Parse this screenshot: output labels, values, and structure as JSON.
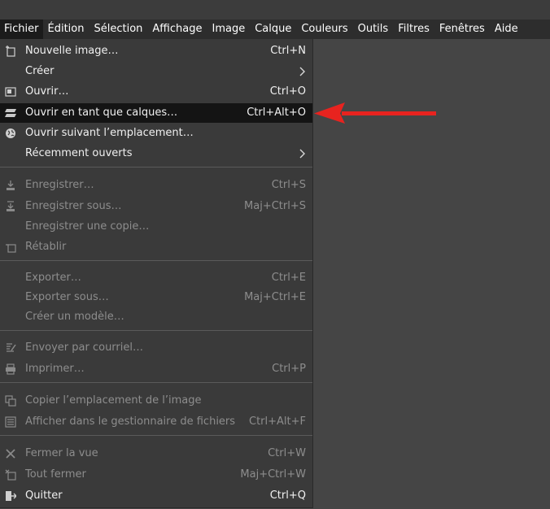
{
  "menubar": {
    "items": [
      "Fichier",
      "Édition",
      "Sélection",
      "Affichage",
      "Image",
      "Calque",
      "Couleurs",
      "Outils",
      "Filtres",
      "Fenêtres",
      "Aide"
    ]
  },
  "file_menu": {
    "items": [
      {
        "label": "Nouvelle image…",
        "shortcut": "Ctrl+N",
        "icon": "new-image-icon",
        "enabled": true
      },
      {
        "label": "Créer",
        "shortcut": "",
        "icon": "",
        "enabled": true,
        "submenu": true
      },
      {
        "label": "Ouvrir…",
        "shortcut": "Ctrl+O",
        "icon": "open-icon",
        "enabled": true
      },
      {
        "label": "Ouvrir en tant que calques…",
        "shortcut": "Ctrl+Alt+O",
        "icon": "layers-icon",
        "enabled": true,
        "selected": true
      },
      {
        "label": "Ouvrir suivant l’emplacement…",
        "shortcut": "",
        "icon": "globe-icon",
        "enabled": true
      },
      {
        "label": "Récemment ouverts",
        "shortcut": "",
        "icon": "",
        "enabled": true,
        "submenu": true
      },
      {
        "label": "Enregistrer…",
        "shortcut": "Ctrl+S",
        "icon": "save-icon",
        "enabled": false
      },
      {
        "label": "Enregistrer sous…",
        "shortcut": "Maj+Ctrl+S",
        "icon": "save-as-icon",
        "enabled": false
      },
      {
        "label": "Enregistrer une copie…",
        "shortcut": "",
        "icon": "",
        "enabled": false
      },
      {
        "label": "Rétablir",
        "shortcut": "",
        "icon": "revert-icon",
        "enabled": false
      },
      {
        "label": "Exporter…",
        "shortcut": "Ctrl+E",
        "icon": "",
        "enabled": false
      },
      {
        "label": "Exporter sous…",
        "shortcut": "Maj+Ctrl+E",
        "icon": "",
        "enabled": false
      },
      {
        "label": "Créer un modèle…",
        "shortcut": "",
        "icon": "",
        "enabled": false
      },
      {
        "label": "Envoyer par courriel…",
        "shortcut": "",
        "icon": "mail-icon",
        "enabled": false
      },
      {
        "label": "Imprimer…",
        "shortcut": "Ctrl+P",
        "icon": "print-icon",
        "enabled": false
      },
      {
        "label": "Copier l’emplacement de l’image",
        "shortcut": "",
        "icon": "copy-location-icon",
        "enabled": false
      },
      {
        "label": "Afficher dans le gestionnaire de fichiers",
        "shortcut": "Ctrl+Alt+F",
        "icon": "file-manager-icon",
        "enabled": false
      },
      {
        "label": "Fermer la vue",
        "shortcut": "Ctrl+W",
        "icon": "close-icon",
        "enabled": false
      },
      {
        "label": "Tout fermer",
        "shortcut": "Maj+Ctrl+W",
        "icon": "close-all-icon",
        "enabled": false
      },
      {
        "label": "Quitter",
        "shortcut": "Ctrl+Q",
        "icon": "quit-icon",
        "enabled": true
      }
    ]
  },
  "annotation": {
    "color": "#e8231f",
    "icon": "red-arrow-pointer"
  }
}
